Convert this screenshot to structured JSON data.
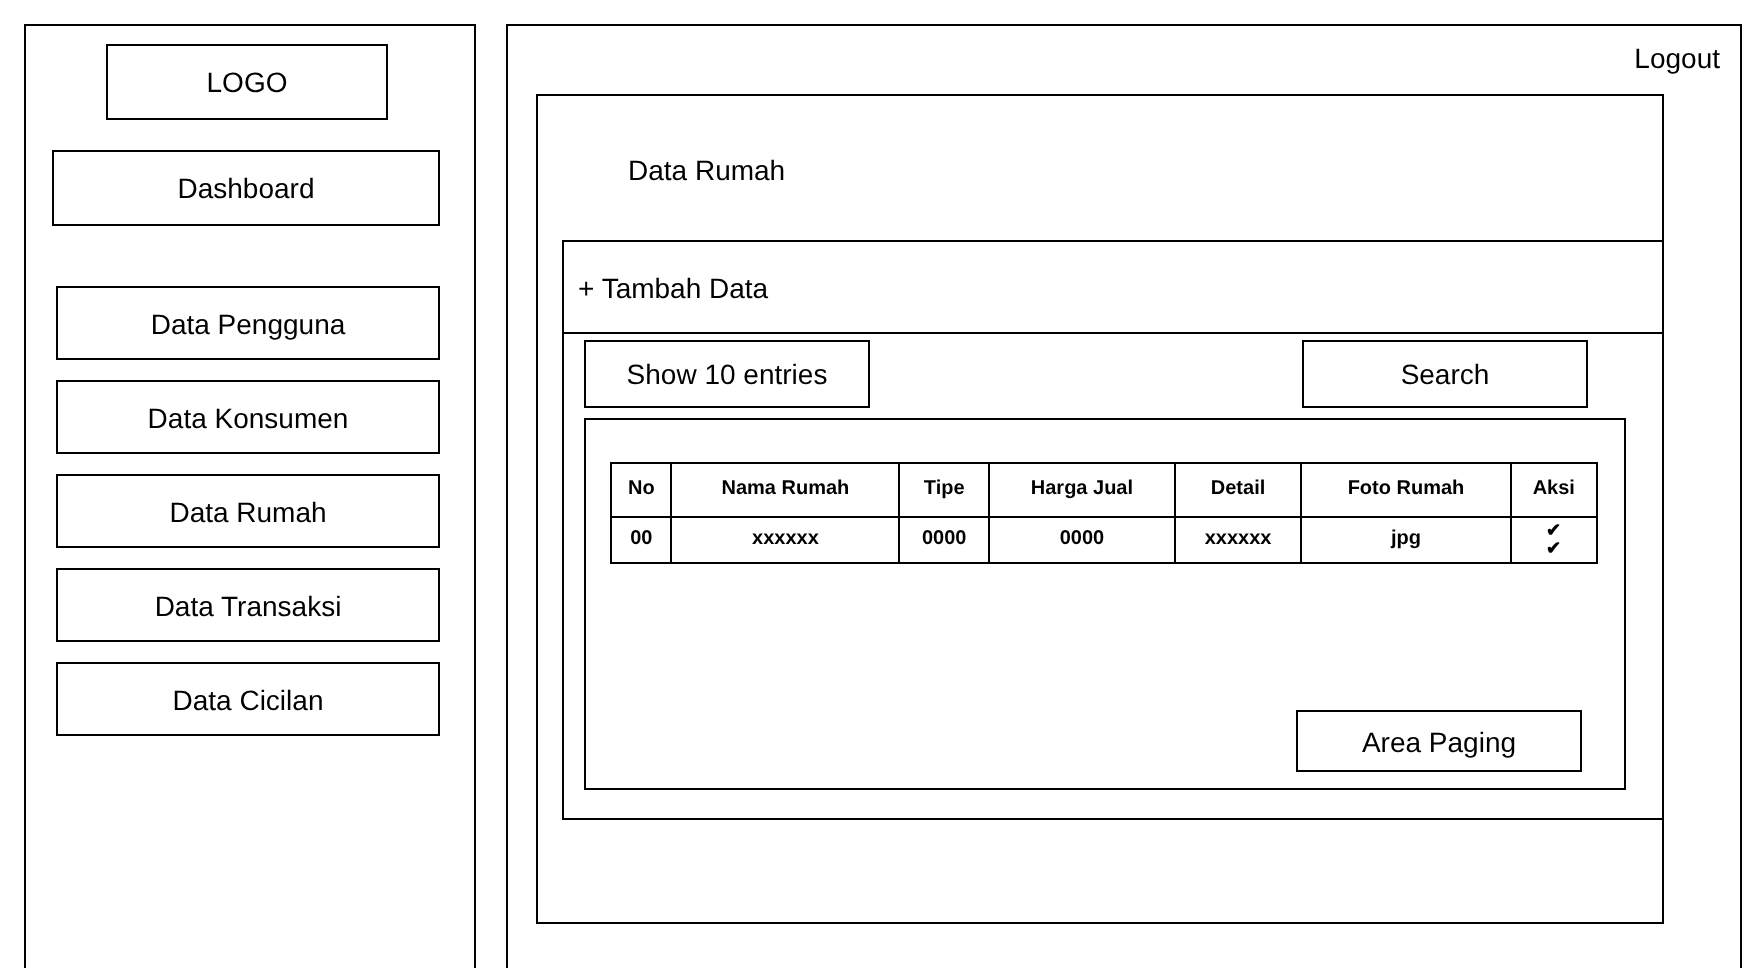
{
  "logo": "LOGO",
  "sidebar": {
    "dashboard": "Dashboard",
    "items": [
      {
        "label": "Data Pengguna"
      },
      {
        "label": "Data Konsumen"
      },
      {
        "label": "Data Rumah"
      },
      {
        "label": "Data Transaksi"
      },
      {
        "label": "Data Cicilan"
      }
    ]
  },
  "logout": "Logout",
  "page_title": "Data Rumah",
  "add_button": "+ Tambah Data",
  "show_entries": "Show 10 entries",
  "search": "Search",
  "table": {
    "columns": [
      "No",
      "Nama Rumah",
      "Tipe",
      "Harga Jual",
      "Detail",
      "Foto Rumah",
      "Aksi"
    ],
    "rows": [
      {
        "cells": [
          "00",
          "xxxxxx",
          "0000",
          "0000",
          "xxxxxx",
          "jpg"
        ],
        "actions": [
          "✔",
          "✔"
        ]
      }
    ]
  },
  "paging": "Area Paging"
}
